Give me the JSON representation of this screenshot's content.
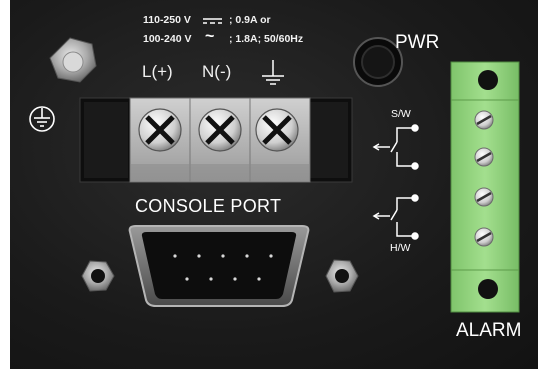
{
  "power_spec": {
    "line1_voltage": "110-250 V",
    "line1_rating": "; 0.9A or",
    "line2_voltage": "100-240 V",
    "line2_symbol": "~",
    "line2_rating": "; 1.8A; 50/60Hz"
  },
  "terminals": {
    "positive": "L(+)",
    "negative": "N(-)"
  },
  "labels": {
    "pwr": "PWR",
    "console_port": "CONSOLE PORT",
    "alarm": "ALARM",
    "sw": "S/W",
    "hw": "H/W"
  },
  "icons": {
    "ground_terminal": "earth-ground-icon",
    "protective_ground": "protective-earth-icon",
    "dc_symbol": "dc-current-icon",
    "relay_switch": "relay-contact-icon"
  },
  "colors": {
    "panel": "#1c1c1c",
    "terminal_block": "#b8b8b8",
    "alarm_connector": "#8fd17c",
    "text": "#ffffff"
  }
}
